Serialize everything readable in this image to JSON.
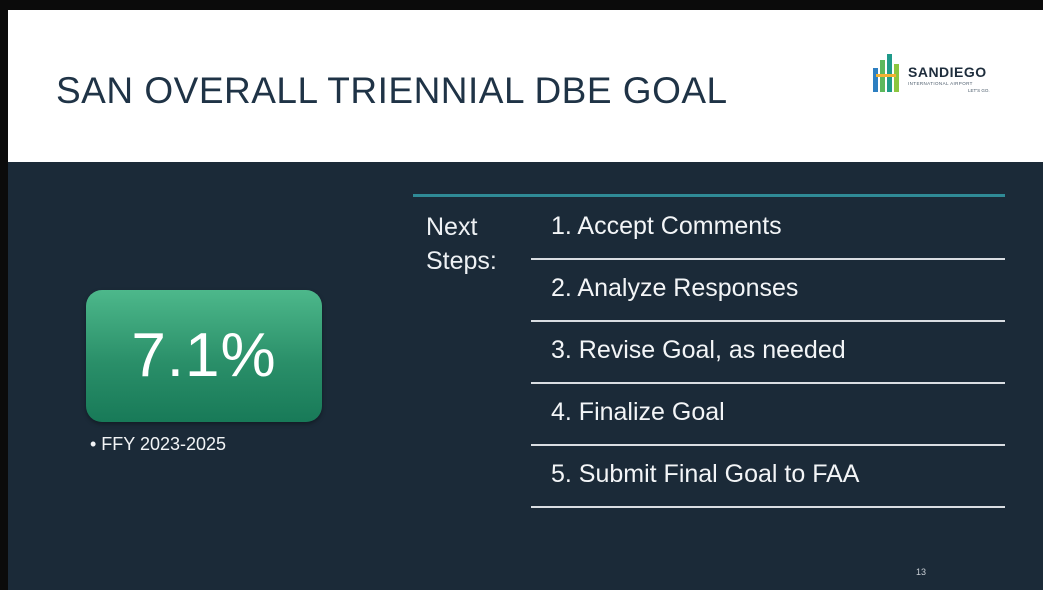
{
  "header": {
    "title": "SAN OVERALL TRIENNIAL DBE GOAL",
    "logo": {
      "wordmark": "SANDIEGO",
      "subtext": "INTERNATIONAL AIRPORT",
      "tagline": "LET'S GO.",
      "icon": "airport-logo-icon"
    }
  },
  "goal": {
    "value": "7.1%",
    "bullet": "• FFY 2023-2025"
  },
  "next_steps": {
    "label_line1": "Next",
    "label_line2": "Steps:",
    "items": [
      "1. Accept Comments",
      "2. Analyze Responses",
      "3. Revise Goal, as needed",
      "4. Finalize Goal",
      "5. Submit Final Goal to FAA"
    ]
  },
  "page_number": "13",
  "colors": {
    "background": "#1b2a38",
    "accent_teal": "#2f8a96",
    "goal_green": "#2a8f69",
    "title_text": "#1f3346"
  }
}
